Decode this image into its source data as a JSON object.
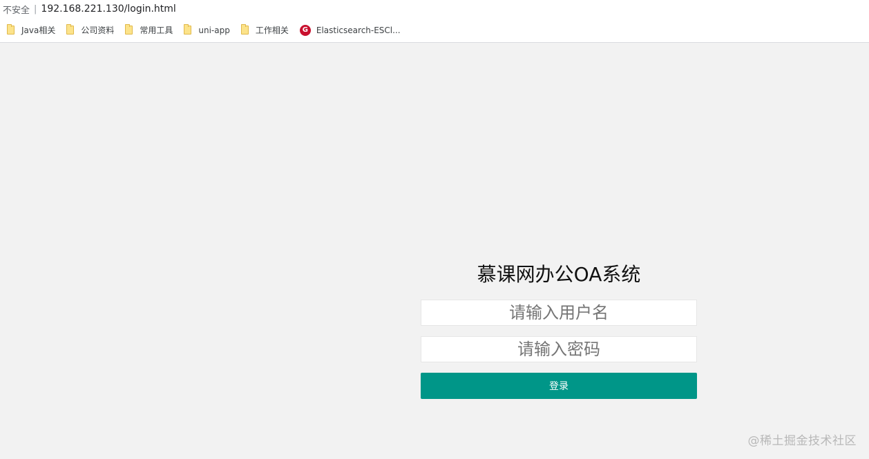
{
  "browser": {
    "security_label": "不安全",
    "separator": "|",
    "url": "192.168.221.130/login.html",
    "bookmarks": [
      {
        "label": "Java相关",
        "icon": "folder-icon"
      },
      {
        "label": "公司资料",
        "icon": "folder-icon"
      },
      {
        "label": "常用工具",
        "icon": "folder-icon"
      },
      {
        "label": "uni-app",
        "icon": "folder-icon"
      },
      {
        "label": "工作相关",
        "icon": "folder-icon"
      },
      {
        "label": "Elasticsearch-ESCl...",
        "icon": "elasticsearch-icon",
        "icon_glyph": "G"
      }
    ]
  },
  "login": {
    "title": "慕课网办公OA系统",
    "username_placeholder": "请输入用户名",
    "password_placeholder": "请输入密码",
    "submit_label": "登录"
  },
  "watermark": "@稀土掘金技术社区",
  "colors": {
    "background": "#f2f2f2",
    "accent": "#009688",
    "folder": "#fce38a",
    "elasticsearch": "#c8102e"
  }
}
